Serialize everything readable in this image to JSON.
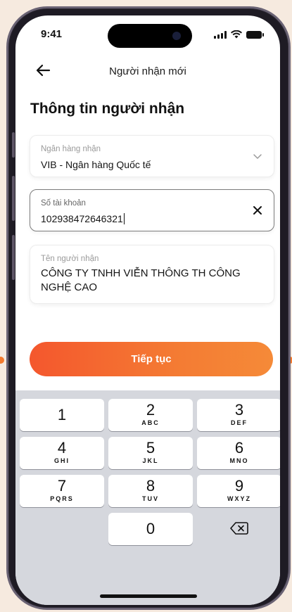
{
  "status_bar": {
    "time": "9:41"
  },
  "nav": {
    "title": "Người nhận mới"
  },
  "section_title": "Thông tin người nhận",
  "bank_field": {
    "label": "Ngân hàng nhận",
    "value": "VIB - Ngân hàng Quốc tế"
  },
  "account_field": {
    "label": "Số tài khoản",
    "value": "102938472646321"
  },
  "name_field": {
    "label": "Tên người nhận",
    "value": "CÔNG TY TNHH VIỄN THÔNG TH CÔNG NGHỆ CAO"
  },
  "cta": {
    "label": "Tiếp tục"
  },
  "keypad": {
    "keys": [
      {
        "digit": "1",
        "letters": ""
      },
      {
        "digit": "2",
        "letters": "ABC"
      },
      {
        "digit": "3",
        "letters": "DEF"
      },
      {
        "digit": "4",
        "letters": "GHI"
      },
      {
        "digit": "5",
        "letters": "JKL"
      },
      {
        "digit": "6",
        "letters": "MNO"
      },
      {
        "digit": "7",
        "letters": "PQRS"
      },
      {
        "digit": "8",
        "letters": "TUV"
      },
      {
        "digit": "9",
        "letters": "WXYZ"
      },
      {
        "digit": "0",
        "letters": ""
      }
    ]
  },
  "colors": {
    "accent": "#f4572d",
    "accent_end": "#f58a38",
    "keypad_bg": "#d5d7dd",
    "page_bg": "#f6eadf"
  },
  "icons": {
    "back": "arrow-left-icon",
    "dropdown": "chevron-down-icon",
    "clear": "close-icon",
    "backspace": "backspace-icon"
  }
}
